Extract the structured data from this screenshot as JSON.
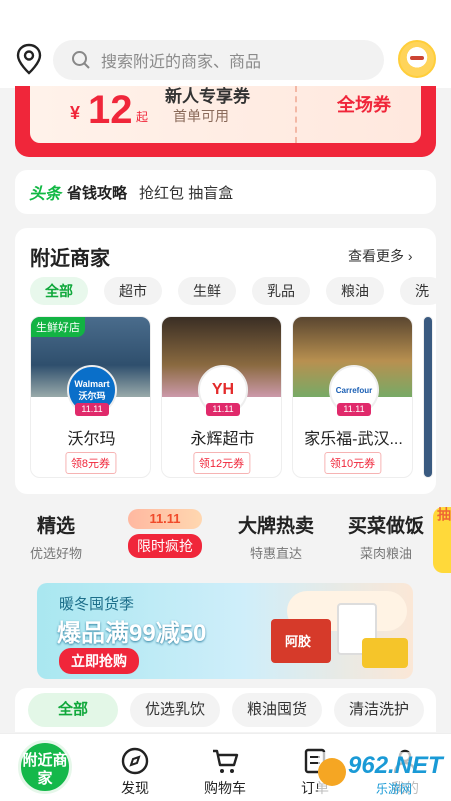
{
  "search": {
    "placeholder": "搜索附近的商家、商品"
  },
  "coupon": {
    "currency": "¥",
    "amount": "12",
    "suffix": "起",
    "title": "新人专享券",
    "subtitle": "首单可用",
    "scope": "全场券"
  },
  "strategy": {
    "tag": "头条",
    "label": "省钱攻略",
    "text": "抢红包 抽盲盒"
  },
  "nearby": {
    "title": "附近商家",
    "more": "查看更多",
    "chips": [
      "全部",
      "超市",
      "生鲜",
      "乳品",
      "粮油",
      "洗"
    ],
    "stores": [
      {
        "name": "沃尔玛",
        "coupon": "领8元券",
        "badge": "生鲜好店",
        "logo": "Walmart 沃尔玛",
        "promo": "11.11",
        "color": "#0a6fc9"
      },
      {
        "name": "永辉超市",
        "coupon": "领12元券",
        "badge": "",
        "logo": "YH",
        "promo": "11.11",
        "color": "#e32a2a"
      },
      {
        "name": "家乐福-武汉...",
        "coupon": "领10元券",
        "badge": "",
        "logo": "Carrefour",
        "promo": "11.11",
        "color": "#1a5fb4"
      }
    ]
  },
  "categories": [
    {
      "title": "精选",
      "sub": "优选好物"
    },
    {
      "title": "11.11",
      "sub": "限时疯抢"
    },
    {
      "title": "大牌热卖",
      "sub": "特惠直达"
    },
    {
      "title": "买菜做饭",
      "sub": "菜肉粮油"
    }
  ],
  "side_tag": "抽",
  "banner": {
    "season": "暖冬囤货季",
    "headline": "爆品满99减50",
    "cta": "立即抢购",
    "product_text": "阿胶"
  },
  "bottom_chips": [
    "全部",
    "优选乳饮",
    "粮油囤货",
    "清洁洗护"
  ],
  "tabbar": {
    "home": "附近商家",
    "items": [
      "发现",
      "购物车",
      "订单",
      "我的"
    ]
  },
  "watermark": {
    "brand": "962.NET",
    "sub": "乐游网"
  }
}
